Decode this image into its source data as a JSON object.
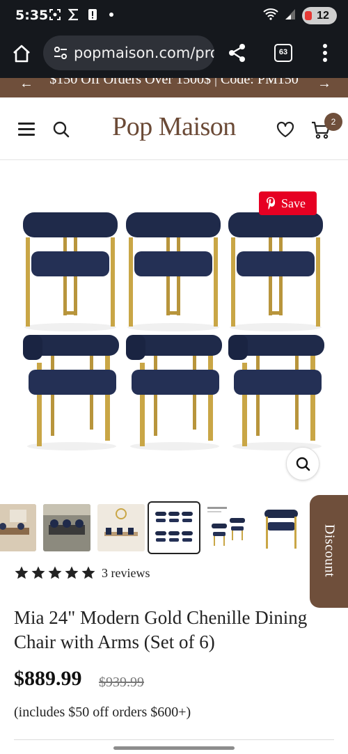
{
  "status_bar": {
    "time": "5:35",
    "icons": [
      "screenshot-icon",
      "sigma-icon",
      "alert-icon",
      "dot-icon"
    ],
    "battery": "12"
  },
  "browser": {
    "url": "popmaison.com/proc",
    "tab_count": "63"
  },
  "promo": {
    "text": "$150 Off Orders Over 1500$ | Code: PM150"
  },
  "header": {
    "logo": "Pop Maison",
    "cart_count": "2"
  },
  "gallery": {
    "pin_label": "Save",
    "thumbnail_count": 6,
    "active_thumbnail": 4
  },
  "discount_tab": {
    "label": "Discount"
  },
  "product": {
    "rating": 5,
    "reviews_label": "3 reviews",
    "title": "Mia 24\" Modern Gold Chenille Dining Chair with Arms (Set of 6)",
    "price": "$889.99",
    "compare_price": "$939.99",
    "note": "(includes $50 off orders $600+)"
  },
  "colors": {
    "brand_brown": "#6f4f3b",
    "pin_red": "#e60023",
    "chair_navy": "#1f2a4a",
    "chair_gold": "#c9a646"
  }
}
